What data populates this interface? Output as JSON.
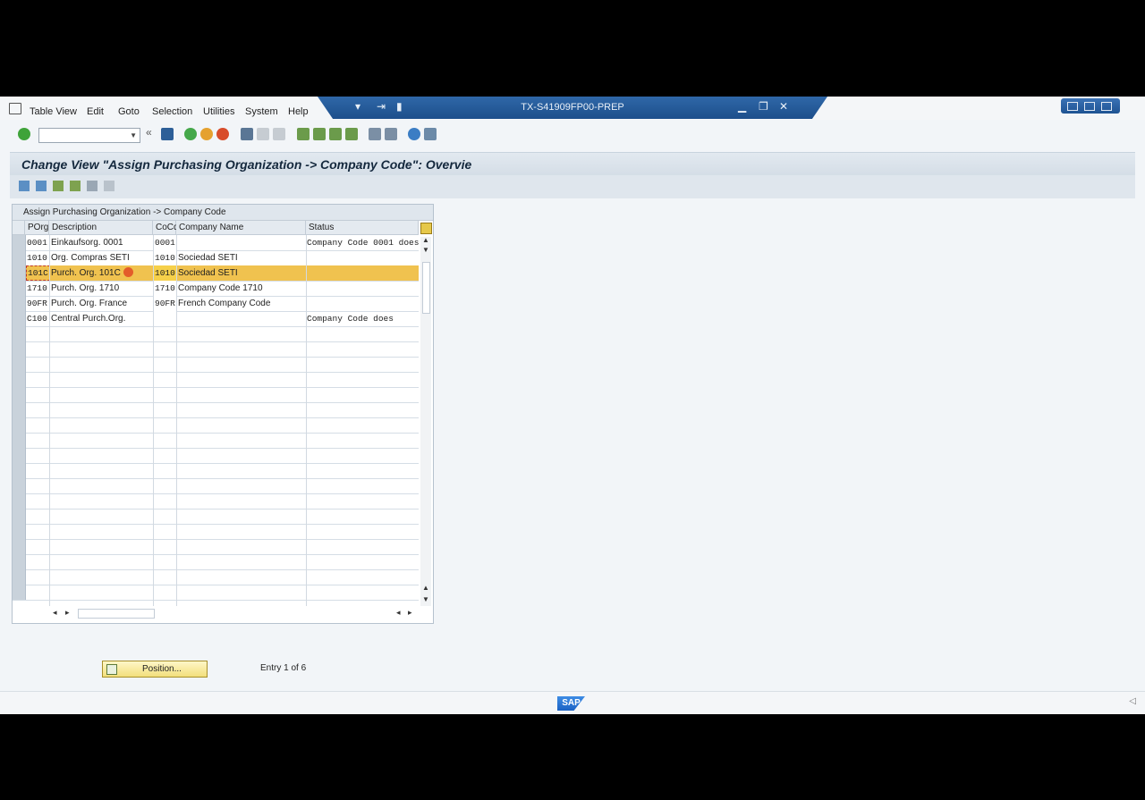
{
  "menubar": {
    "items": [
      "Table View",
      "Edit",
      "Goto",
      "Selection",
      "Utilities",
      "System",
      "Help"
    ],
    "window_title": "TX-S41909FP00-PREP"
  },
  "toolbar": {
    "command_field": "",
    "icons": [
      "enter-icon",
      "save-icon",
      "back-icon",
      "exit-icon",
      "cancel-icon",
      "print-icon",
      "find-icon",
      "find-next-icon",
      "first-page-icon",
      "prev-page-icon",
      "next-page-icon",
      "last-page-icon",
      "create-session-icon",
      "shortcut-icon",
      "help-icon",
      "customize-layout-icon"
    ]
  },
  "page": {
    "title": "Change View \"Assign Purchasing  Organization -> Company Code\": Overvie"
  },
  "table": {
    "caption": "Assign Purchasing  Organization -> Company Code",
    "columns": [
      "POrg",
      "Description",
      "CoCd",
      "Company Name",
      "Status"
    ],
    "rows": [
      {
        "porg": "0001",
        "desc": "Einkaufsorg. 0001",
        "cocd": "0001",
        "cname": "",
        "status": "Company Code 0001 does"
      },
      {
        "porg": "1010",
        "desc": "Org. Compras SETI",
        "cocd": "1010",
        "cname": "Sociedad SETI",
        "status": ""
      },
      {
        "porg": "101C",
        "desc": "Purch. Org. 101C",
        "cocd": "1010",
        "cname": "Sociedad SETI",
        "status": ""
      },
      {
        "porg": "1710",
        "desc": "Purch. Org. 1710",
        "cocd": "1710",
        "cname": "Company Code 1710",
        "status": ""
      },
      {
        "porg": "90FR",
        "desc": "Purch. Org. France",
        "cocd": "90FR",
        "cname": "French Company Code",
        "status": ""
      },
      {
        "porg": "C100",
        "desc": "Central Purch.Org.",
        "cocd": "",
        "cname": "",
        "status": "Company Code       does"
      }
    ],
    "selected_row": 2
  },
  "footer": {
    "position_label": "Position...",
    "entry_text": "Entry 1 of 6"
  },
  "colors": {
    "title_strip": "#1d4f8b",
    "selected_row": "#f0c24f",
    "position_button": "#f2df7c"
  }
}
